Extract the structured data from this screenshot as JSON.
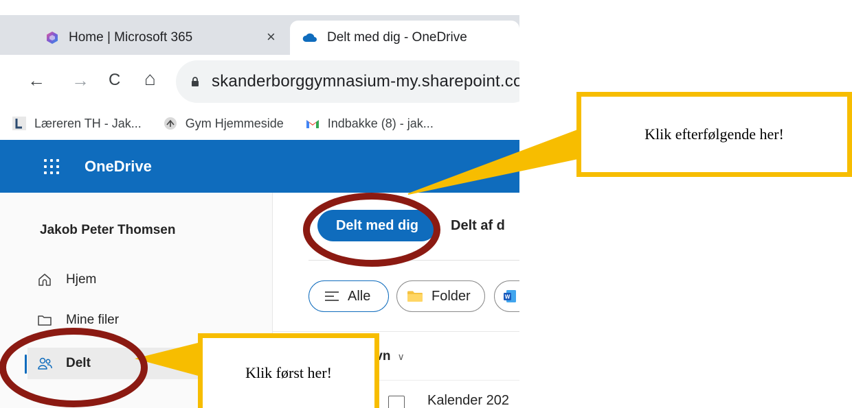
{
  "browser": {
    "tabs": [
      {
        "title": "Home | Microsoft 365",
        "favicon": "microsoft365-icon",
        "close_label": "×"
      },
      {
        "title": "Delt med dig - OneDrive",
        "favicon": "onedrive-cloud-icon"
      }
    ],
    "nav": {
      "back": "←",
      "forward": "→",
      "reload": "C",
      "home": "⌂"
    },
    "url": "skanderborggymnasium-my.sharepoint.co",
    "bookmarks": [
      {
        "label": "Læreren TH - Jak...",
        "icon": "laereren-icon"
      },
      {
        "label": "Gym Hjemmeside",
        "icon": "gym-hjemmeside-icon"
      },
      {
        "label": "Indbakke (8) - jak...",
        "icon": "gmail-icon"
      }
    ]
  },
  "onedrive": {
    "app_title": "OneDrive",
    "user_name": "Jakob Peter Thomsen",
    "nav_items": [
      {
        "label": "Hjem",
        "icon": "home-icon"
      },
      {
        "label": "Mine filer",
        "icon": "folder-icon"
      },
      {
        "label": "Delt",
        "icon": "people-icon",
        "selected": true
      }
    ],
    "shared_tabs": [
      "Delt med dig",
      "Delt af d"
    ],
    "filters": [
      "Alle",
      "Folder"
    ],
    "column_name": "Navn",
    "sort_chevron": "∨",
    "partial_file": "Kalender 202"
  },
  "annotations": {
    "top_callout": "Klik efterfølgende her!",
    "bottom_callout": "Klik først her!"
  },
  "colors": {
    "onedrive_blue": "#0f6cbd",
    "callout_yellow": "#f7bd00",
    "circle_red": "#8b1a12"
  }
}
